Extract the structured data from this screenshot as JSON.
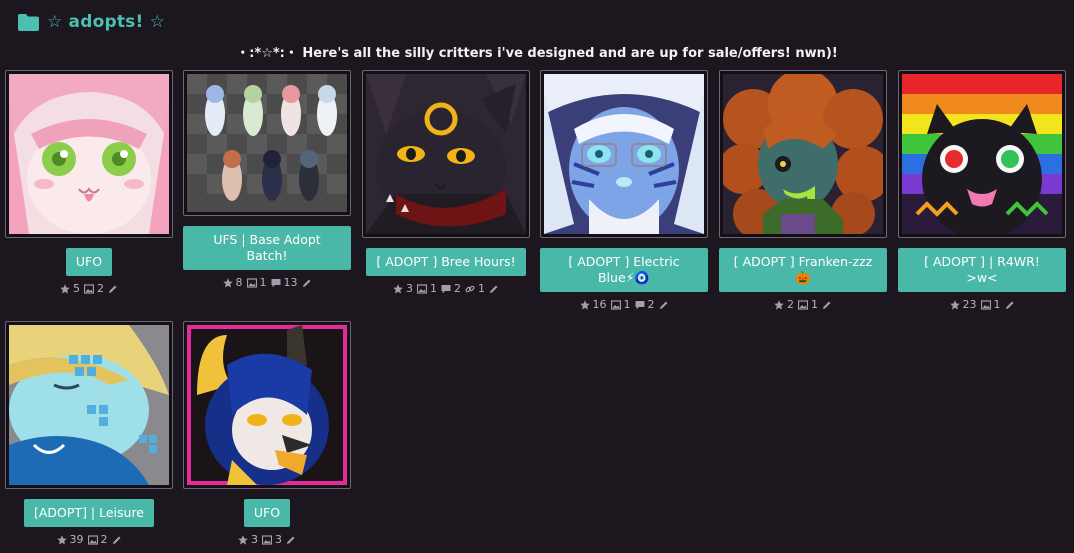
{
  "folder": {
    "title": "☆ adopts! ☆",
    "accent": "#4cbfb0"
  },
  "subtitle": "・:*☆*:・ Here's all the silly critters i've designed and are up for sale/offers! nwn)!",
  "cards": [
    {
      "title": "UFO",
      "favorites": "5",
      "images": "2"
    },
    {
      "title": "UFS | Base Adopt Batch!",
      "favorites": "8",
      "images": "1",
      "comments": "13"
    },
    {
      "title": "[ ADOPT ] Bree Hours!",
      "favorites": "3",
      "images": "1",
      "comments": "2",
      "links": "1"
    },
    {
      "title": "[ ADOPT ] Electric Blue⚡🧿",
      "favorites": "16",
      "images": "1",
      "comments": "2"
    },
    {
      "title": "[ ADOPT ] Franken-zzz 🎃",
      "favorites": "2",
      "images": "1"
    },
    {
      "title": "[ ADOPT ] | R4WR! >w<",
      "favorites": "23",
      "images": "1"
    },
    {
      "title": "[ADOPT] | Leisure",
      "favorites": "39",
      "images": "2"
    },
    {
      "title": "UFO",
      "favorites": "3",
      "images": "3"
    }
  ],
  "colors": {
    "background": "#1c171e",
    "button": "#4ab8a9",
    "thumb_border": "#6f6577"
  },
  "icons": {
    "folder": "folder-icon",
    "favorites": "star-icon",
    "images": "image-icon",
    "comments": "comment-icon",
    "links": "link-icon",
    "edit": "pencil-icon"
  }
}
